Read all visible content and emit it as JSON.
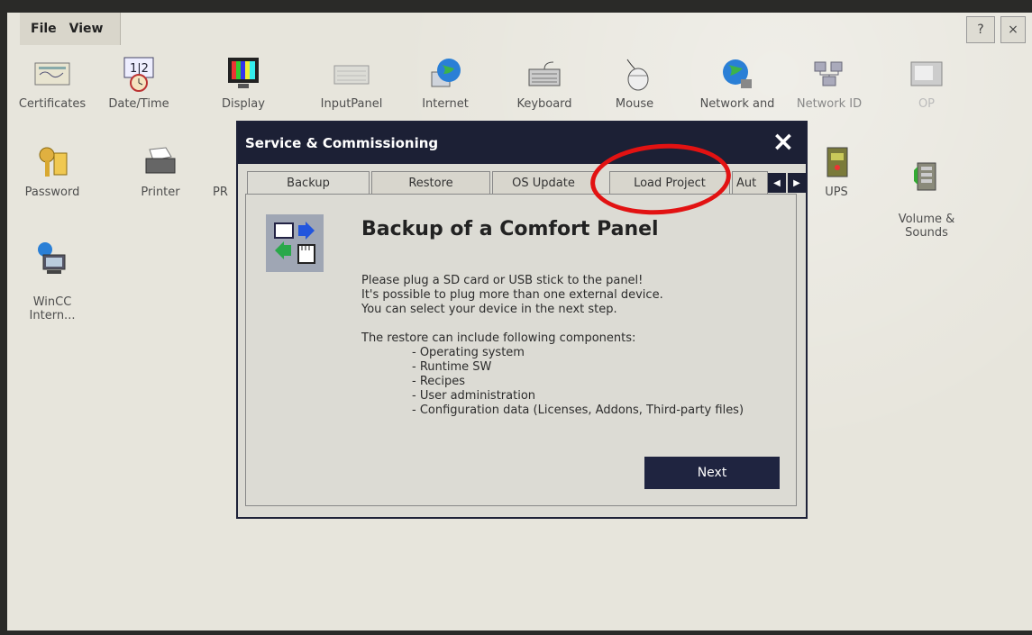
{
  "menubar": {
    "file": "File",
    "view": "View"
  },
  "toolbar": {
    "help": "?",
    "close": "×"
  },
  "control_panel": {
    "row1": [
      {
        "label": "Certificates",
        "icon": "certificate-icon"
      },
      {
        "label": "Date/Time",
        "icon": "clock-icon"
      },
      {
        "label": "Display",
        "icon": "display-icon"
      },
      {
        "label": "InputPanel",
        "icon": "keyboard-panel-icon"
      },
      {
        "label": "Internet",
        "icon": "globe-icon"
      },
      {
        "label": "Keyboard",
        "icon": "keyboard-icon"
      },
      {
        "label": "Mouse",
        "icon": "mouse-icon"
      },
      {
        "label": "Network and",
        "icon": "network-globe-icon"
      },
      {
        "label": "Network ID",
        "icon": "network-id-icon"
      },
      {
        "label": "OP",
        "icon": "op-icon"
      }
    ],
    "row2": [
      {
        "label": "Password",
        "icon": "key-icon"
      },
      {
        "label": "Printer",
        "icon": "printer-icon"
      },
      {
        "label": "PR",
        "icon": "profinet-icon"
      },
      {
        "label": "UPS",
        "icon": "ups-icon"
      },
      {
        "label": "Volume &\nSounds",
        "icon": "speaker-icon"
      }
    ],
    "row3": [
      {
        "label": "WinCC\nIntern...",
        "icon": "wincc-icon"
      }
    ]
  },
  "dialog": {
    "title": "Service & Commissioning",
    "tabs": [
      "Backup",
      "Restore",
      "OS Update",
      "Load Project",
      "Aut"
    ],
    "active_tab": "Backup",
    "heading": "Backup of a Comfort Panel",
    "intro": [
      "Please plug a SD card or USB stick to the panel!",
      "It's possible to plug more than one external device.",
      "You can select your device in the next step."
    ],
    "components_title": "The restore can include following components:",
    "components": [
      "- Operating system",
      "- Runtime SW",
      "- Recipes",
      "- User administration",
      "- Configuration data (Licenses, Addons, Third-party files)"
    ],
    "next_label": "Next"
  },
  "colors": {
    "titlebar": "#1c2035",
    "highlight": "#e21212",
    "background": "#e7e5dc"
  }
}
